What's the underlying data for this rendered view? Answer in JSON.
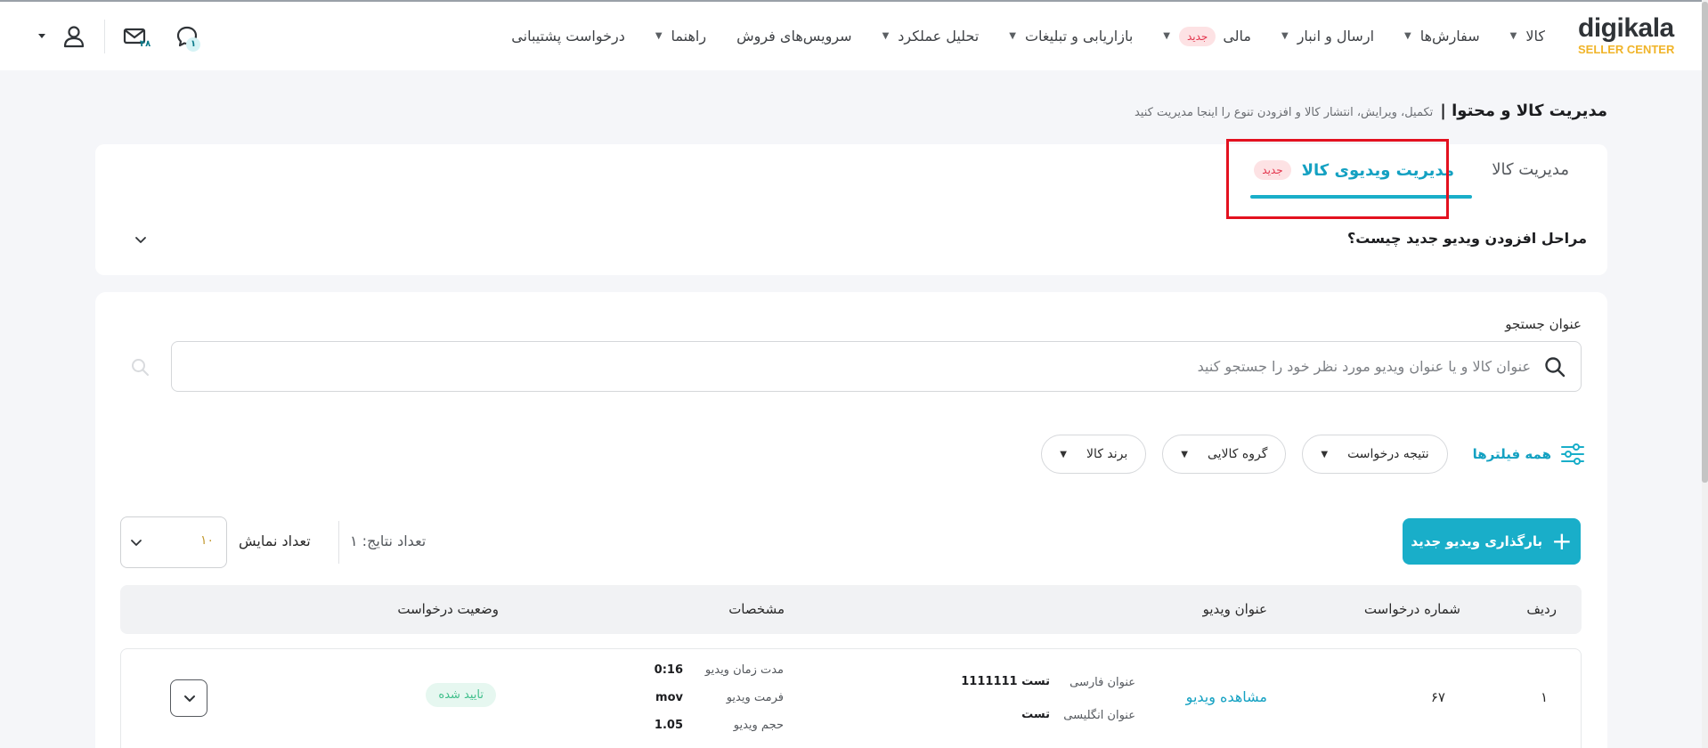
{
  "header": {
    "logo_text": "digikala",
    "logo_sub": "SELLER CENTER",
    "nav": [
      {
        "label": "کالا",
        "caret": true
      },
      {
        "label": "سفارش‌ها",
        "caret": true
      },
      {
        "label": "ارسال و انبار",
        "caret": true
      },
      {
        "label": "مالی",
        "caret": true,
        "badge": "جدید"
      },
      {
        "label": "بازاریابی و تبلیغات",
        "caret": true
      },
      {
        "label": "تحلیل عملکرد",
        "caret": true
      },
      {
        "label": "سرویس‌های فروش",
        "caret": false
      },
      {
        "label": "راهنما",
        "caret": true
      },
      {
        "label": "درخواست پشتیبانی",
        "caret": false
      }
    ],
    "messages_count": "۴۸",
    "notifications_count": "۱"
  },
  "page": {
    "title": "مدیریت کالا و محتوا |",
    "subtitle": "تکمیل، ویرایش، انتشار کالا و افزودن تنوع را اینجا مدیریت کنید"
  },
  "tabs": {
    "manage_label": "مدیریت کالا",
    "video_label": "مدیریت ویدیوی کالا",
    "video_badge": "جدید"
  },
  "faq": {
    "label": "مراحل افزودن ویدیو جدید چیست؟"
  },
  "search": {
    "label": "عنوان جستجو",
    "placeholder": "عنوان کالا و یا عنوان ویدیو مورد نظر خود را جستجو کنید",
    "value": ""
  },
  "filters": {
    "all_label": "همه فیلترها",
    "items": [
      "نتیجه درخواست",
      "گروه کالایی",
      "برند کالا"
    ]
  },
  "toolbar": {
    "upload_label": "بارگذاری ویدیو جدید",
    "results_label": "تعداد نتایج: ۱",
    "page_size_label": "تعداد نمایش",
    "page_size_value": "۱۰"
  },
  "table": {
    "headers": {
      "row": "ردیف",
      "request_no": "شماره درخواست",
      "video_title": "عنوان ویدیو",
      "specs": "مشخصات",
      "status": "وضعیت درخواست"
    },
    "rows": [
      {
        "row": "۱",
        "request_no": "۶۷",
        "view_link": "مشاهده ویدیو",
        "fa_title_label": "عنوان فارسی",
        "fa_title_value": "تست 1111111",
        "en_title_label": "عنوان انگلیسی",
        "en_title_value": "تست",
        "duration_label": "مدت زمان ویدیو",
        "duration_value": "0:16",
        "format_label": "فرمت ویدیو",
        "format_value": "mov",
        "size_label": "حجم ویدیو",
        "size_value": "1.05",
        "status": "تایید شده"
      }
    ]
  },
  "colors": {
    "accent": "#19aec9",
    "highlight": "#e3111f",
    "success": "#3fbf8b",
    "logo_yellow": "#f0b429"
  }
}
